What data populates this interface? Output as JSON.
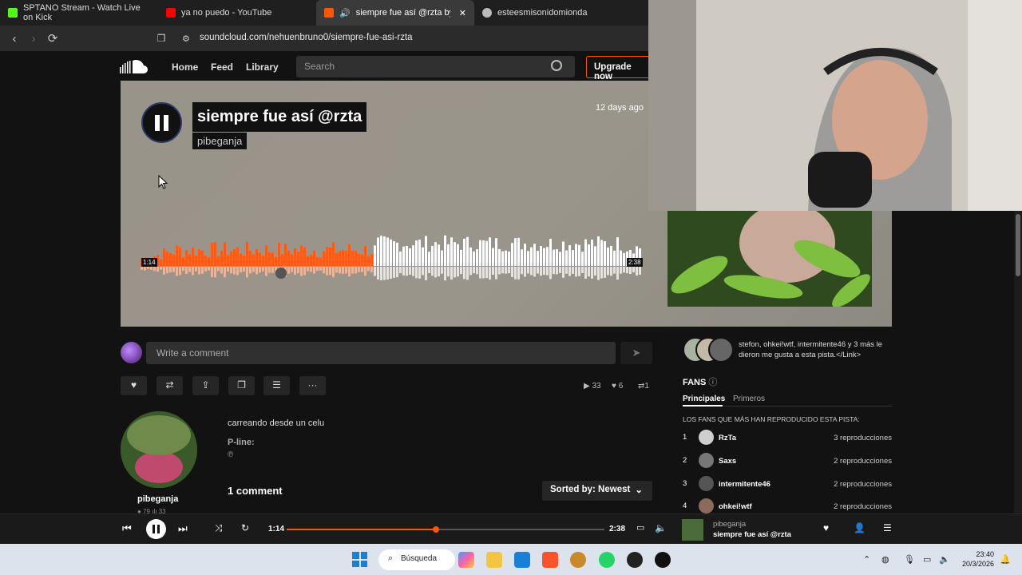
{
  "tabs": [
    {
      "label": "SPTANO Stream - Watch Live on Kick",
      "color": "#53fc18"
    },
    {
      "label": "ya no puedo - YouTube",
      "color": "#ff0000"
    },
    {
      "label": "siempre fue así @rzta by pibe",
      "color": "#ff5500"
    },
    {
      "label": "esteesmisonidomionda",
      "color": "#bbbbbb"
    }
  ],
  "browser": {
    "url": "soundcloud.com/nehuenbruno0/siempre-fue-asi-rzta"
  },
  "header": {
    "nav": [
      "Home",
      "Feed",
      "Library"
    ],
    "search_placeholder": "Search",
    "upgrade": "Upgrade now"
  },
  "track": {
    "title": "siempre fue así @rzta",
    "artist": "pibeganja",
    "posted": "12 days ago",
    "elapsed": "1:14",
    "duration": "2:38",
    "progress": 0.468
  },
  "comment": {
    "placeholder": "Write a comment",
    "send_icon": "send-icon"
  },
  "actions": [
    "heart-icon",
    "repost-icon",
    "share-icon",
    "copy-link-icon",
    "add-to-playlist-icon",
    "more-icon"
  ],
  "stats": {
    "plays": "33",
    "likes": "6",
    "reposts": "1"
  },
  "profile": {
    "name": "pibeganja",
    "followers": "79",
    "tracks": "33"
  },
  "description": {
    "text": "carreando desde un celu",
    "pline_label": "P-line:",
    "pline_symbol": "℗"
  },
  "comments": {
    "count_label": "1 comment",
    "sort_label": "Sorted by: Newest"
  },
  "likes_box": {
    "text": "stefon, ohkei!wtf, intermitente46 y 3 más le dieron me gusta a esta pista.</Link>"
  },
  "fans": {
    "title": "FANS",
    "tabs": [
      "Principales",
      "Primeros"
    ],
    "heading": "LOS FANS QUE MÁS HAN REPRODUCIDO ESTA PISTA:",
    "rows": [
      {
        "rank": "1",
        "name": "RzTa",
        "plays": "3 reproducciones"
      },
      {
        "rank": "2",
        "name": "Saxs",
        "plays": "2 reproducciones"
      },
      {
        "rank": "3",
        "name": "intermitente46",
        "plays": "2 reproducciones"
      },
      {
        "rank": "4",
        "name": "ohkei!wtf",
        "plays": "2 reproducciones"
      }
    ]
  },
  "player": {
    "elapsed": "1:14",
    "duration": "2:38",
    "progress": 0.47,
    "artist": "pibeganja",
    "title": "siempre fue así @rzta"
  },
  "taskbar": {
    "search": "Búsqueda",
    "time": "23:40",
    "date": "20/3/2026"
  }
}
